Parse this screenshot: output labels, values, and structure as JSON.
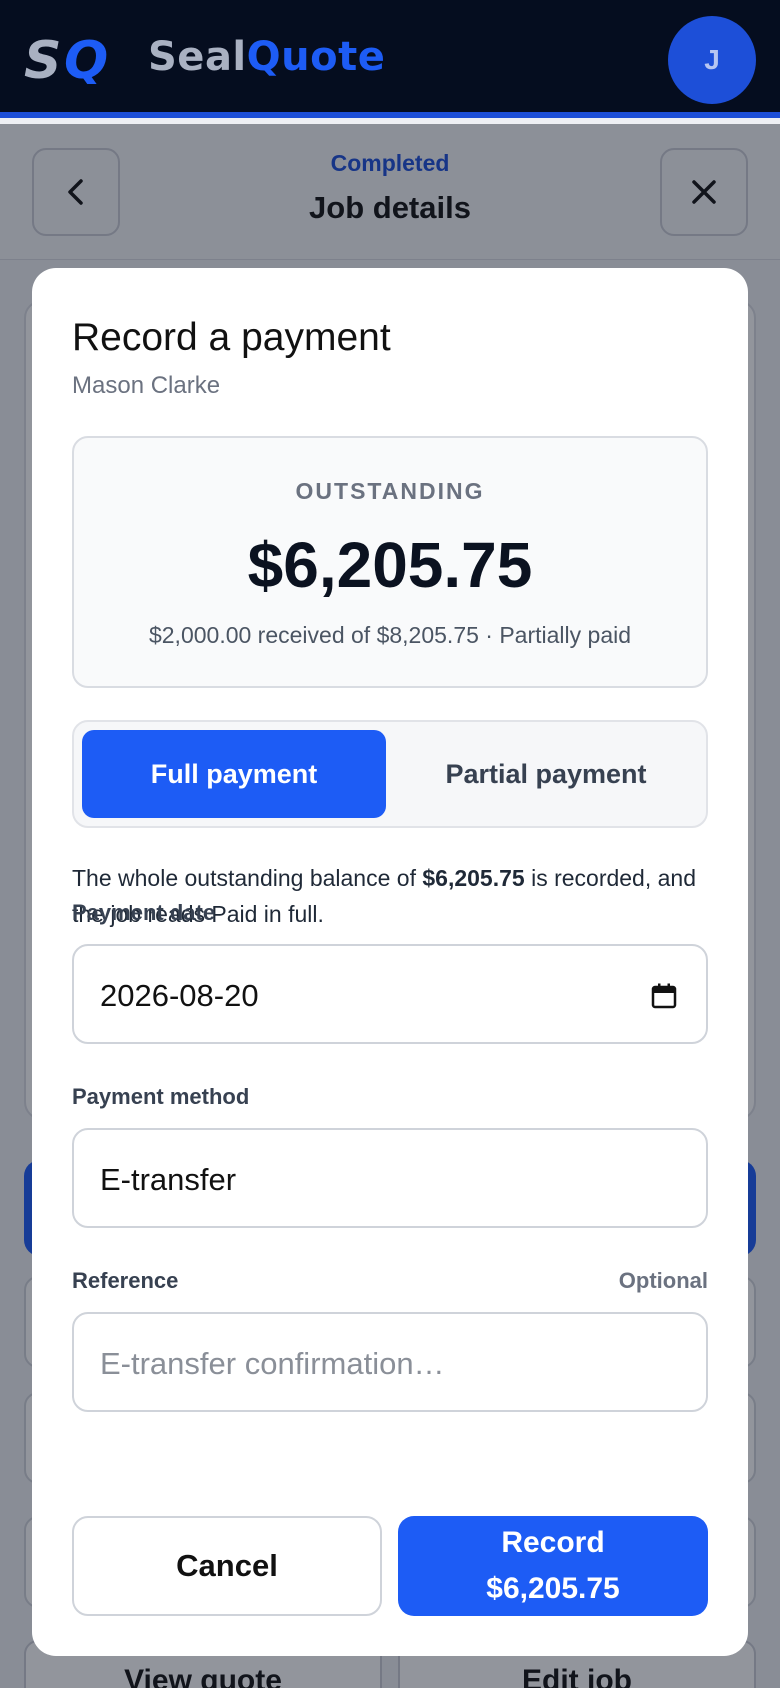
{
  "brand": {
    "logo_mark": "SQ",
    "name_part1": "Seal",
    "name_part2": "Quote",
    "avatar_initial": "J",
    "accent": "#1d5cf5",
    "header_bg": "#050d1f"
  },
  "page_header": {
    "status": "Completed",
    "title": "Job details",
    "back_icon": "chevron-left-icon",
    "close_icon": "close-icon"
  },
  "background": {
    "bottom_left_button": "View quote",
    "bottom_right_button": "Edit job"
  },
  "modal": {
    "title": "Record a payment",
    "customer_name": "Mason Clarke",
    "summary": {
      "label": "OUTSTANDING",
      "amount": "$6,205.75",
      "note": "$2,000.00 received of $8,205.75 · Partially paid"
    },
    "payment_type": {
      "options": [
        "Full payment",
        "Partial payment"
      ],
      "selected": "Full payment"
    },
    "description": {
      "before": "The whole outstanding balance of ",
      "amount": "$6,205.75",
      "after": " is recorded, and the job reads Paid in full."
    },
    "payment_date": {
      "label": "Payment date",
      "value": "2026-08-20",
      "icon": "calendar-icon"
    },
    "payment_method": {
      "label": "Payment method",
      "value": "E-transfer"
    },
    "reference": {
      "label": "Reference",
      "optional_label": "Optional",
      "placeholder": "E-transfer confirmation…",
      "value": ""
    },
    "actions": {
      "cancel": "Cancel",
      "record_line1": "Record",
      "record_line2": "$6,205.75"
    }
  }
}
